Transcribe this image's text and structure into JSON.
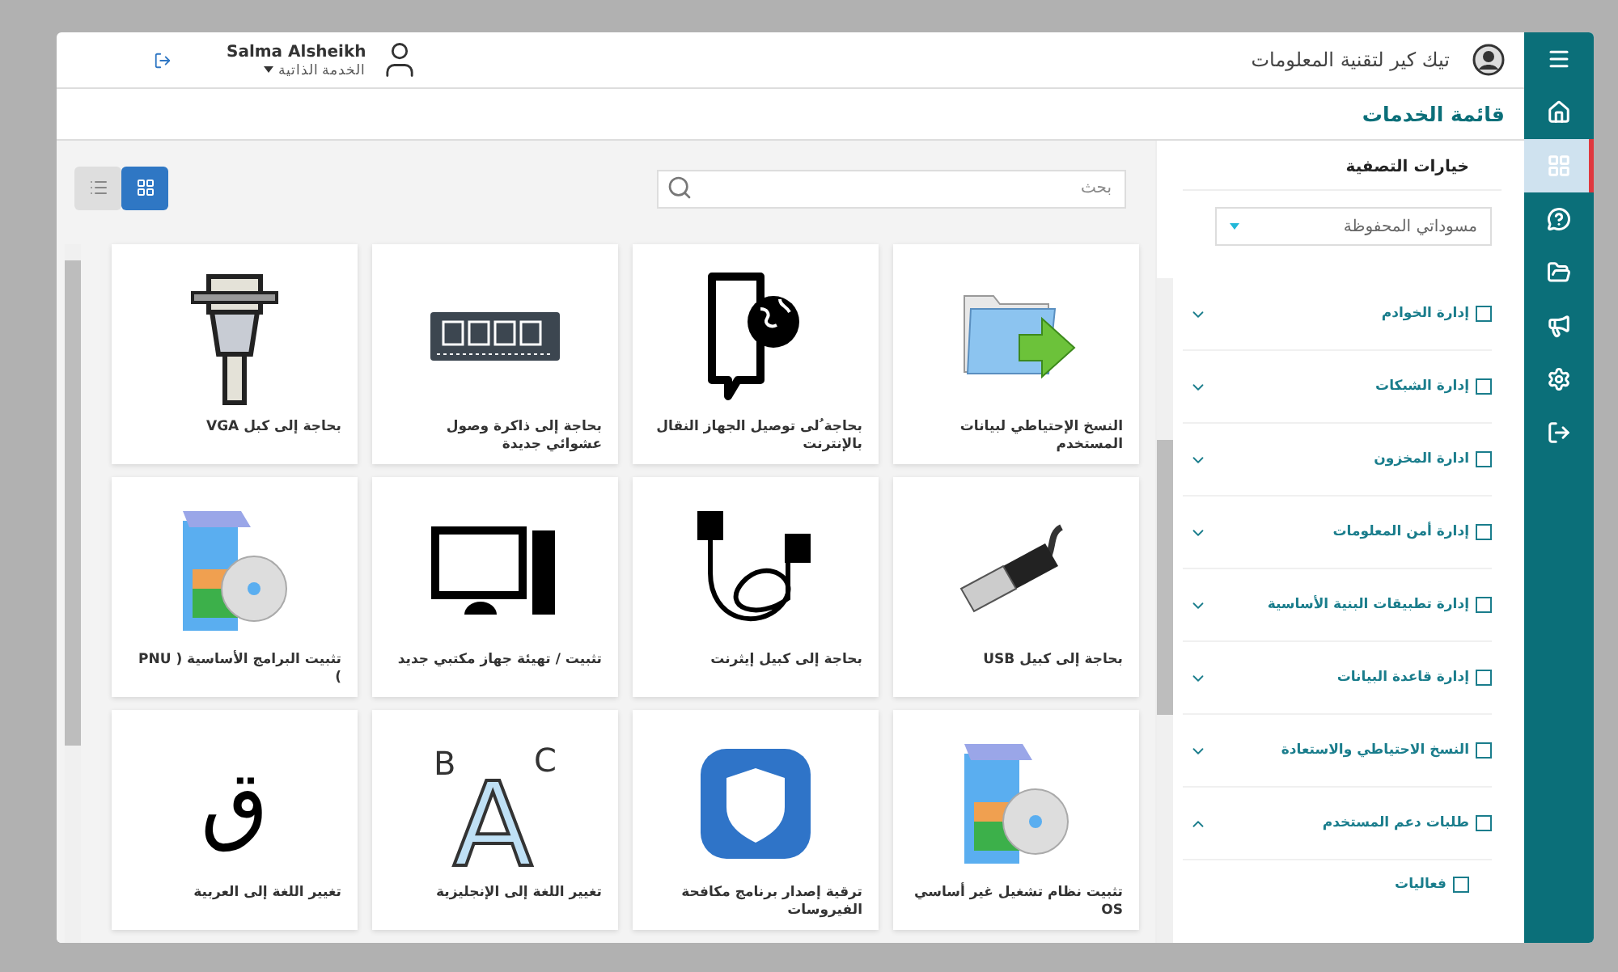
{
  "header": {
    "org_name": "تيك كير لتقنية المعلومات",
    "user_name": "Salma Alsheikh",
    "user_role": "الخدمة الذاتية"
  },
  "sidebar": {
    "items": [
      {
        "selected": false
      },
      {
        "selected": false
      },
      {
        "selected": true
      },
      {
        "selected": false
      },
      {
        "selected": false
      },
      {
        "selected": false
      },
      {
        "selected": false
      },
      {
        "selected": false
      }
    ]
  },
  "page_title": "قائمة الخدمات",
  "filters": {
    "title": "خيارات التصفية",
    "dropdown": {
      "value": "مسوداتي المحفوظة"
    },
    "categories": [
      {
        "label": "إدارة الخوادم",
        "checked": false,
        "expanded": false
      },
      {
        "label": "إدارة الشبكات",
        "checked": false,
        "expanded": false
      },
      {
        "label": "ادارة المخزون",
        "checked": false,
        "expanded": false
      },
      {
        "label": "إدارة أمن المعلومات",
        "checked": false,
        "expanded": false
      },
      {
        "label": "إدارة تطبيقات البنية الأساسية",
        "checked": false,
        "expanded": false
      },
      {
        "label": "إدارة قاعدة البيانات",
        "checked": false,
        "expanded": false
      },
      {
        "label": "النسخ الاحتياطي والاستعادة",
        "checked": false,
        "expanded": false
      },
      {
        "label": "طلبات دعم المستخدم",
        "checked": false,
        "expanded": true,
        "children": [
          {
            "label": "فعاليات",
            "checked": false
          }
        ]
      }
    ]
  },
  "search": {
    "placeholder": "بحث"
  },
  "view_toggle": [
    {
      "selected": false
    },
    {
      "selected": true
    }
  ],
  "services": [
    {
      "title": "النسخ الإحتياطي لبيانات المستخدم",
      "kind": "backup"
    },
    {
      "title": "بحاجة ُلى توصيل الجهاز النقال بالإنترنت",
      "kind": "phone"
    },
    {
      "title": "بحاجة إلى ذاكرة وصول عشوائي جديدة",
      "kind": "ram"
    },
    {
      "title": "بحاجة إلى كبل VGA",
      "kind": "vga"
    },
    {
      "title": "بحاجة إلى كبيل USB",
      "kind": "usb"
    },
    {
      "title": "بحاجة إلى كبيل إيثرنت",
      "kind": "ethernet"
    },
    {
      "title": "تثبيت / تهيئة جهاز مكتبي جديد",
      "kind": "computer"
    },
    {
      "title": "تثبيت البرامج الأساسية ( PNU )",
      "kind": "box"
    },
    {
      "title": "تثبيت نظام تشغيل غير أساسي OS",
      "kind": "box"
    },
    {
      "title": "ترقية إصدار برنامج مكافحة الفيروسات",
      "kind": "shield"
    },
    {
      "title": "تغيير اللغة إلى الإنجليزية",
      "kind": "letters",
      "glyphs": [
        "B",
        "A",
        "C"
      ]
    },
    {
      "title": "تغيير اللغة إلى العربية",
      "kind": "glyph",
      "glyph": "ق"
    }
  ]
}
